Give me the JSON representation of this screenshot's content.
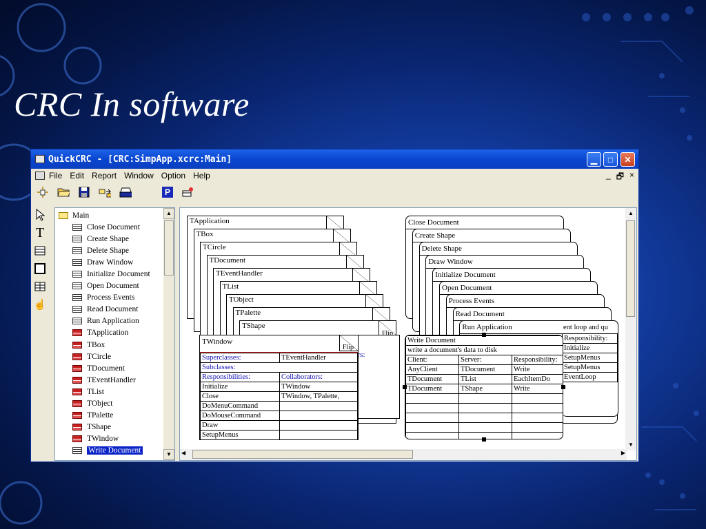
{
  "slide": {
    "title": "CRC In software"
  },
  "window": {
    "title": "QuickCRC - [CRC:SimpApp.xcrc:Main]",
    "menu": [
      "File",
      "Edit",
      "Report",
      "Window",
      "Option",
      "Help"
    ],
    "mdi_controls": [
      "_",
      "🗗",
      "×"
    ]
  },
  "toolbar": {
    "tools": [
      "new-icon",
      "open-folder-icon",
      "save-icon",
      "export-icon",
      "print-icon",
      "p-icon",
      "eraser-icon"
    ],
    "p_label": "P"
  },
  "palette": [
    "pointer-icon",
    "text-tool-icon",
    "card-tool-icon",
    "box-tool-icon",
    "grid-tool-icon",
    "hand-icon"
  ],
  "tree": {
    "root": "Main",
    "items": [
      {
        "label": "Close Document",
        "type": "scenario"
      },
      {
        "label": "Create Shape",
        "type": "scenario"
      },
      {
        "label": "Delete Shape",
        "type": "scenario"
      },
      {
        "label": "Draw Window",
        "type": "scenario"
      },
      {
        "label": "Initialize Document",
        "type": "scenario"
      },
      {
        "label": "Open Document",
        "type": "scenario"
      },
      {
        "label": "Process Events",
        "type": "scenario"
      },
      {
        "label": "Read Document",
        "type": "scenario"
      },
      {
        "label": "Run Application",
        "type": "scenario"
      },
      {
        "label": "TApplication",
        "type": "class"
      },
      {
        "label": "TBox",
        "type": "class"
      },
      {
        "label": "TCircle",
        "type": "class"
      },
      {
        "label": "TDocument",
        "type": "class"
      },
      {
        "label": "TEventHandler",
        "type": "class"
      },
      {
        "label": "TList",
        "type": "class"
      },
      {
        "label": "TObject",
        "type": "class"
      },
      {
        "label": "TPalette",
        "type": "class"
      },
      {
        "label": "TShape",
        "type": "class"
      },
      {
        "label": "TWindow",
        "type": "class"
      },
      {
        "label": "Write Document",
        "type": "scenario",
        "selected": true
      }
    ]
  },
  "class_cards": {
    "stack": [
      "TApplication",
      "TBox",
      "TCircle",
      "TDocument",
      "TEventHandler",
      "TList",
      "TObject",
      "TPalette",
      "TShape"
    ],
    "flip_label": "Flip",
    "behind_fragment": "ors:",
    "front": {
      "name": "TWindow",
      "superclasses_label": "Superclasses:",
      "superclass": "TEventHandler",
      "subclasses_label": "Subclasses:",
      "responsibilities_label": "Responsibilities:",
      "collaborators_label": "Collaborators:",
      "rows": [
        [
          "Initialize",
          "TWindow"
        ],
        [
          "Close",
          "TWindow, TPalette,"
        ],
        [
          "DoMenuCommand",
          ""
        ],
        [
          "DoMouseCommand",
          ""
        ],
        [
          "Draw",
          ""
        ],
        [
          "SetupMenus",
          ""
        ]
      ]
    }
  },
  "scenario_cards": {
    "stack": [
      "Close Document",
      "Create Shape",
      "Delete Shape",
      "Draw Window",
      "Initialize Document",
      "Open Document",
      "Process Events",
      "Read Document",
      "Run Application"
    ],
    "behind_desc": "ent loop and qu",
    "behind_header": "Responsibility:",
    "behind_rows": [
      "Initialize",
      "SetupMenus",
      "SetupMenus",
      "EventLoop"
    ],
    "front": {
      "name": "Write Document",
      "description": "write a document's data to disk",
      "headers": [
        "Client:",
        "Server:",
        "Responsibility:"
      ],
      "rows": [
        [
          "AnyClient",
          "TDocument",
          "Write"
        ],
        [
          "TDocument",
          "TList",
          "EachItemDo"
        ],
        [
          "TDocument",
          "TShape",
          "Write"
        ]
      ]
    }
  }
}
